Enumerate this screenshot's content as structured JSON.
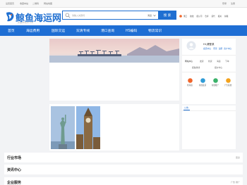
{
  "topbar": {
    "left": [
      "设置首页",
      "收藏本站",
      "二维码",
      "网站地图"
    ],
    "right_user": "登录",
    "right_register": "注册"
  },
  "logo": {
    "name": "鲸鱼海运网",
    "domain": "jingyuhaiyun.com"
  },
  "search": {
    "placeholder": "请输入关键词",
    "scope": "海运",
    "button": "搜 索"
  },
  "hotlinks": [
    "港口",
    "航线",
    "船公司",
    "仓库",
    "货代",
    "报关",
    "拼箱"
  ],
  "nav": [
    "首页",
    "海运费用",
    "国际交运",
    "双清专线",
    "港口查询",
    "HS编码",
    "物流常识"
  ],
  "user": {
    "greeting": "Hi,请登录",
    "links": [
      "会员中心",
      "登录",
      "注册",
      "商户中心"
    ],
    "group_title": "网站中心",
    "items": [
      "发货",
      "找货",
      "海运",
      "下单"
    ],
    "mid": [
      "报备航线",
      "报价中心"
    ],
    "icons": [
      "找海运",
      "在线发货",
      "在线推广",
      "广告投放"
    ]
  },
  "tabpanel": {
    "tab": "公告"
  },
  "sections": [
    {
      "title": "行业市场",
      "more": "更多"
    },
    {
      "title": "资讯中心",
      "more": ""
    },
    {
      "title": "企业服务",
      "more": "广告  推广"
    }
  ],
  "colors": {
    "brand": "#1e6ed4",
    "accent": "#f0652a"
  }
}
